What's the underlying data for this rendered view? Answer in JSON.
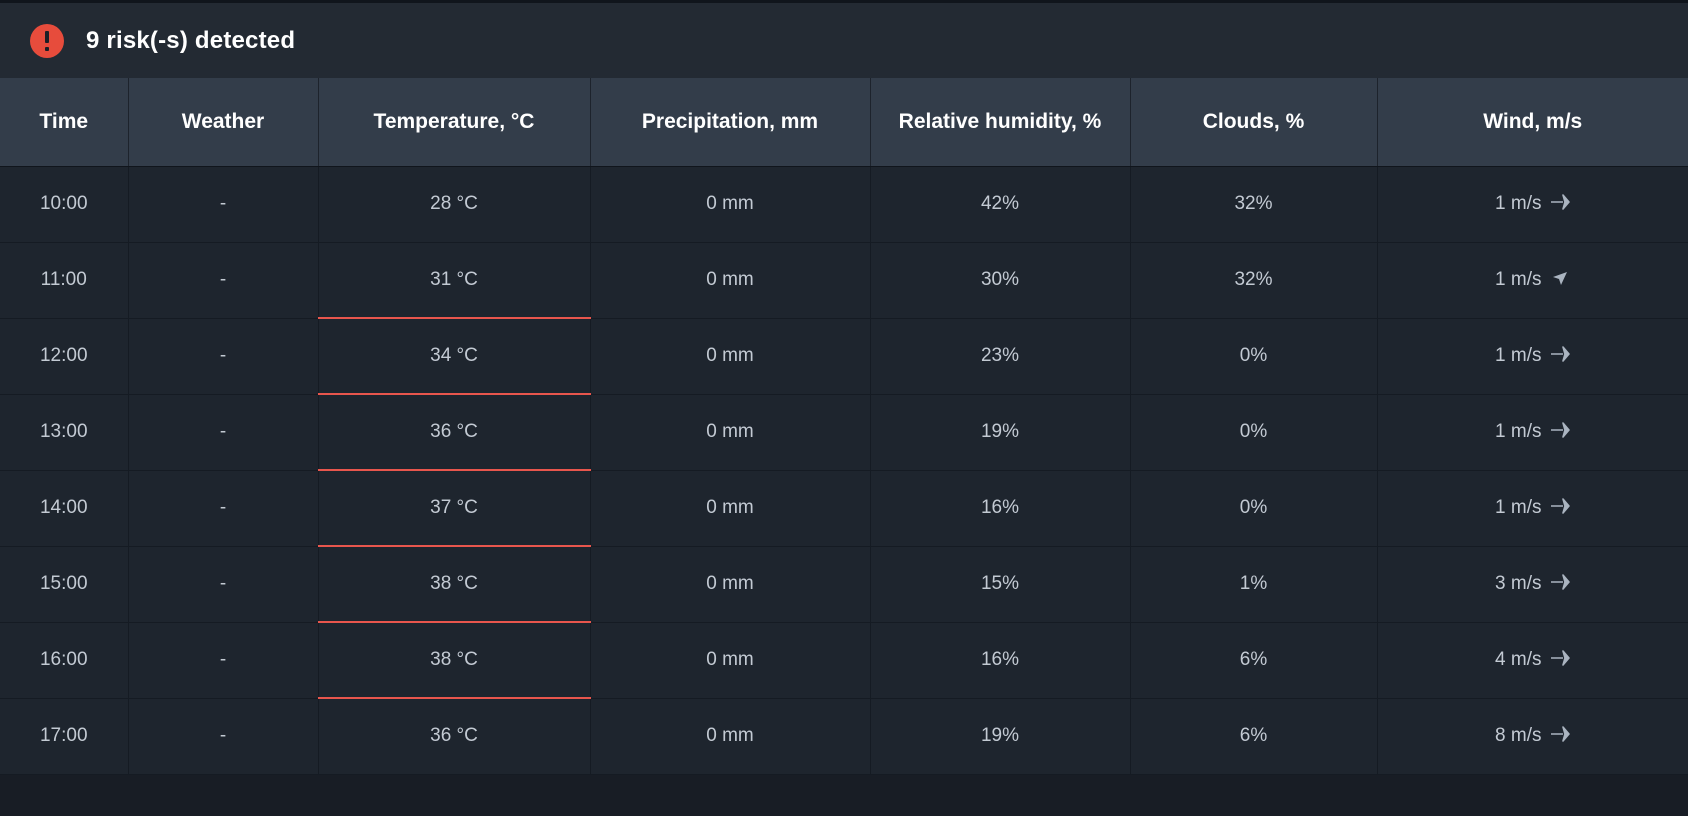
{
  "banner": {
    "icon": "alert-circle-icon",
    "text": "9 risk(-s) detected",
    "icon_color": "#e74c3c",
    "background": "#232a33"
  },
  "table": {
    "columns": [
      {
        "key": "time",
        "label": "Time"
      },
      {
        "key": "weather",
        "label": "Weather"
      },
      {
        "key": "temp",
        "label": "Temperature, °C"
      },
      {
        "key": "prec",
        "label": "Precipitation, mm"
      },
      {
        "key": "hum",
        "label": "Relative humidity, %"
      },
      {
        "key": "clouds",
        "label": "Clouds, %"
      },
      {
        "key": "wind",
        "label": "Wind, m/s"
      }
    ],
    "rows": [
      {
        "time": "10:00",
        "weather": "-",
        "temp": "28 °C",
        "prec": "0 mm",
        "hum": "42%",
        "clouds": "32%",
        "wind": "1 m/s",
        "wind_dir": "east",
        "temp_risk": false,
        "temp_sep": false,
        "selected": false
      },
      {
        "time": "11:00",
        "weather": "-",
        "temp": "31 °C",
        "prec": "0 mm",
        "hum": "30%",
        "clouds": "32%",
        "wind": "1 m/s",
        "wind_dir": "northwest",
        "temp_risk": true,
        "temp_sep": false,
        "selected": false
      },
      {
        "time": "12:00",
        "weather": "-",
        "temp": "34 °C",
        "prec": "0 mm",
        "hum": "23%",
        "clouds": "0%",
        "wind": "1 m/s",
        "wind_dir": "east",
        "temp_risk": true,
        "temp_sep": true,
        "selected": false
      },
      {
        "time": "13:00",
        "weather": "-",
        "temp": "36 °C",
        "prec": "0 mm",
        "hum": "19%",
        "clouds": "0%",
        "wind": "1 m/s",
        "wind_dir": "east",
        "temp_risk": true,
        "temp_sep": true,
        "selected": true
      },
      {
        "time": "14:00",
        "weather": "-",
        "temp": "37 °C",
        "prec": "0 mm",
        "hum": "16%",
        "clouds": "0%",
        "wind": "1 m/s",
        "wind_dir": "east",
        "temp_risk": true,
        "temp_sep": true,
        "selected": false
      },
      {
        "time": "15:00",
        "weather": "-",
        "temp": "38 °C",
        "prec": "0 mm",
        "hum": "15%",
        "clouds": "1%",
        "wind": "3 m/s",
        "wind_dir": "east",
        "temp_risk": true,
        "temp_sep": true,
        "selected": false
      },
      {
        "time": "16:00",
        "weather": "-",
        "temp": "38 °C",
        "prec": "0 mm",
        "hum": "16%",
        "clouds": "6%",
        "wind": "4 m/s",
        "wind_dir": "east",
        "temp_risk": true,
        "temp_sep": true,
        "selected": false
      },
      {
        "time": "17:00",
        "weather": "-",
        "temp": "36 °C",
        "prec": "0 mm",
        "hum": "19%",
        "clouds": "6%",
        "wind": "8 m/s",
        "wind_dir": "east",
        "temp_risk": true,
        "temp_sep": true,
        "selected": false
      }
    ]
  },
  "colors": {
    "page_background": "#181d25",
    "header_background": "#333d4a",
    "cell_background": "#1e252e",
    "time_cell_background": "#333d4a",
    "risk_cell_background": "#5a3338",
    "risk_separator": "#e8564d",
    "selected_row_background": "#2b4465",
    "selected_time_cell_background": "#3b5a80",
    "selected_risk_cell_background": "#56414f",
    "text": "#c3cad3",
    "header_text": "#ffffff"
  }
}
